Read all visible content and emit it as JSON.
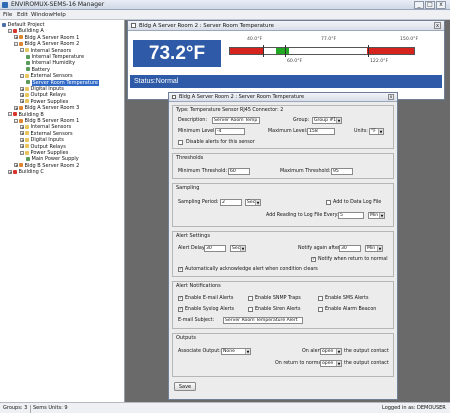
{
  "app": {
    "title": "ENVIROMUX-SEMS-16 Manager",
    "menu": [
      "File",
      "Edit",
      "Window",
      "Help"
    ]
  },
  "tree": [
    {
      "label": "Default Project",
      "depth": 0,
      "icon": "project-icon",
      "tw": ""
    },
    {
      "label": "Building A",
      "depth": 1,
      "icon": "building-icon",
      "tw": "-"
    },
    {
      "label": "Bldg A Server Room 1",
      "depth": 2,
      "icon": "room-icon",
      "tw": "+"
    },
    {
      "label": "Bldg A Server Room 2",
      "depth": 2,
      "icon": "room-icon",
      "tw": "-"
    },
    {
      "label": "Internal Sensors",
      "depth": 3,
      "icon": "folder-icon",
      "tw": "-"
    },
    {
      "label": "Internal Temperature",
      "depth": 4,
      "icon": "sensor-icon",
      "tw": ""
    },
    {
      "label": "Internal Humidity",
      "depth": 4,
      "icon": "sensor-icon",
      "tw": ""
    },
    {
      "label": "Battery",
      "depth": 4,
      "icon": "sensor-icon",
      "tw": ""
    },
    {
      "label": "External Sensors",
      "depth": 3,
      "icon": "folder-icon",
      "tw": "-"
    },
    {
      "label": "Server Room Temperature",
      "depth": 4,
      "icon": "sensor-icon",
      "tw": "",
      "selected": true
    },
    {
      "label": "Digital Inputs",
      "depth": 3,
      "icon": "folder-icon",
      "tw": "+"
    },
    {
      "label": "Output Relays",
      "depth": 3,
      "icon": "folder-icon",
      "tw": "+"
    },
    {
      "label": "Power Supplies",
      "depth": 3,
      "icon": "folder-icon",
      "tw": "+"
    },
    {
      "label": "Bldg A Server Room 3",
      "depth": 2,
      "icon": "room-icon",
      "tw": "+"
    },
    {
      "label": "Building B",
      "depth": 1,
      "icon": "building-icon",
      "tw": "-"
    },
    {
      "label": "Bldg B Server Room 1",
      "depth": 2,
      "icon": "room-icon",
      "tw": "-"
    },
    {
      "label": "Internal Sensors",
      "depth": 3,
      "icon": "folder-icon",
      "tw": "+"
    },
    {
      "label": "External Sensors",
      "depth": 3,
      "icon": "folder-icon",
      "tw": "+"
    },
    {
      "label": "Digital Inputs",
      "depth": 3,
      "icon": "folder-icon",
      "tw": "+"
    },
    {
      "label": "Output Relays",
      "depth": 3,
      "icon": "folder-icon",
      "tw": "+"
    },
    {
      "label": "Power Supplies",
      "depth": 3,
      "icon": "folder-icon",
      "tw": "-"
    },
    {
      "label": "Main Power Supply",
      "depth": 4,
      "icon": "sensor-icon",
      "tw": ""
    },
    {
      "label": "Bldg B Server Room 2",
      "depth": 2,
      "icon": "room-icon",
      "tw": "+"
    },
    {
      "label": "Building C",
      "depth": 1,
      "icon": "building-icon",
      "tw": "+"
    }
  ],
  "sensor_window": {
    "title": "Bldg A Server Room 2 : Server Room Temperature",
    "value": "73.2°F",
    "status": "Status:Normal",
    "range_labels": {
      "lo_outer": "40.0°F",
      "lo_inner": "60.0°F",
      "hi_inner": "77.0°F",
      "hi_outer": "150.0°F",
      "warn_hi": "122.0°F"
    },
    "gauge": {
      "min": 40,
      "max": 150,
      "low_alert": 60,
      "high_alert": 122,
      "current": 73.2,
      "colors": {
        "alert": "#d6231d",
        "ok": "#23a823"
      }
    }
  },
  "dialog": {
    "title": "Bldg A Server Room 2 : Server Room Temperature",
    "type_line": "Type: Temperature Sensor  RJ45 Connector: 2",
    "description_label": "Description:",
    "description_value": "Server Room Temp",
    "group_label": "Group:",
    "group_value": "Group #1",
    "min_level_label": "Minimum Level:",
    "min_level_value": "-4",
    "max_level_label": "Maximum Level:",
    "max_level_value": "158",
    "units_label": "Units:",
    "units_value": "°F",
    "disable_alerts_label": "Disable alerts for this sensor",
    "thresholds": {
      "title": "Thresholds",
      "min_label": "Minimum Threshold:",
      "min_value": "60",
      "max_label": "Maximum Threshold:",
      "max_value": "95"
    },
    "sampling": {
      "title": "Sampling",
      "period_label": "Sampling Period:",
      "period_value": "2",
      "period_unit": "Sec",
      "add_to_log_label": "Add to Data Log File",
      "add_every_label": "Add Reading to Log File Every:",
      "add_every_value": "5",
      "add_every_unit": "Min"
    },
    "alert_settings": {
      "title": "Alert Settings",
      "delay_label": "Alert Delay:",
      "delay_value": "30",
      "delay_unit": "Sec",
      "notify_again_label": "Notify again after:",
      "notify_again_value": "30",
      "notify_again_unit": "Min",
      "notify_normal_label": "Notify when return to normal",
      "auto_ack_label": "Automatically acknowledge alert when condition clears"
    },
    "alert_notifications": {
      "title": "Alert Notifications",
      "email": "Enable E-mail Alerts",
      "snmp": "Enable SNMP Traps",
      "sms": "Enable SMS Alerts",
      "syslog": "Enable Syslog Alerts",
      "siren": "Enable Siren Alerts",
      "beacon": "Enable Alarm Beacon",
      "subject_label": "E-mail Subject:",
      "subject_value": "Server Room Temperature Alert"
    },
    "outputs": {
      "title": "Outputs",
      "assoc_label": "Associate Output:",
      "assoc_value": "None",
      "on_alert_label": "On alert",
      "on_alert_value": "open",
      "on_alert_suffix": "the output contact",
      "on_return_label": "On return to normal",
      "on_return_value": "open",
      "on_return_suffix": "the output contact"
    },
    "save_label": "Save"
  },
  "statusbar": {
    "groups": "Groups: 3",
    "sems_units": "Sems Units: 9",
    "logged_in": "Logged in as: DEMOUSER"
  }
}
